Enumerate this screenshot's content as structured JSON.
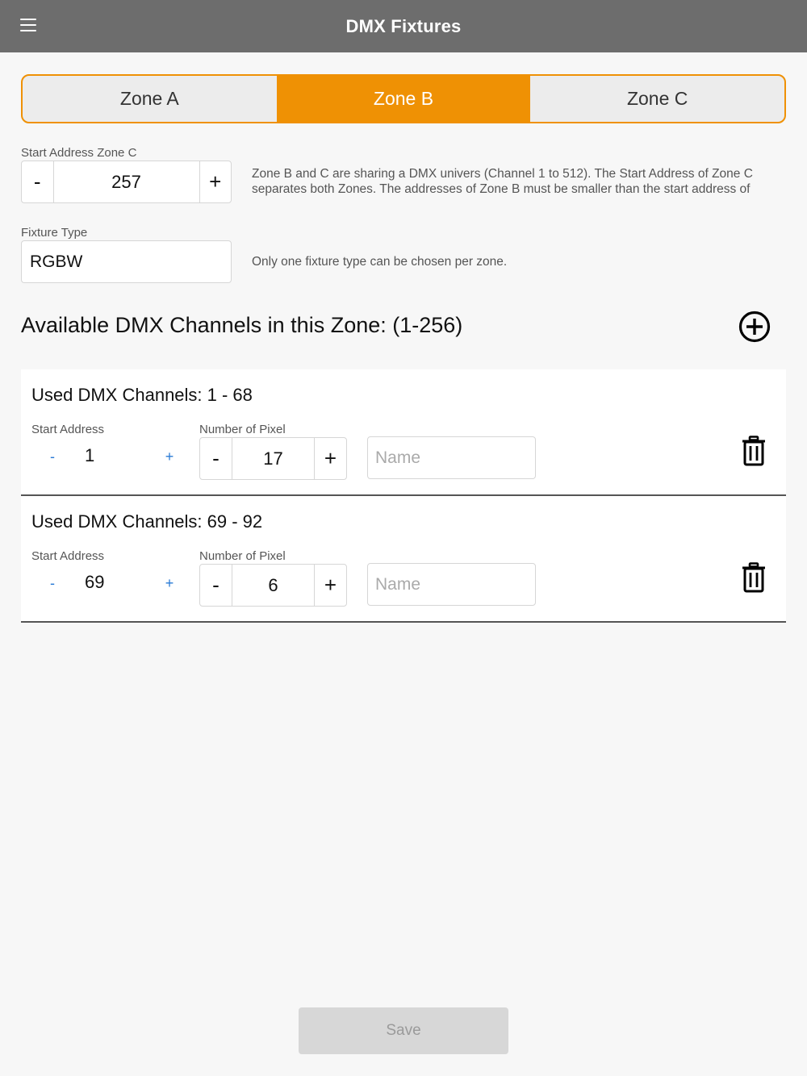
{
  "header": {
    "title": "DMX Fixtures",
    "menu_icon": "hamburger-menu-icon"
  },
  "zones": [
    {
      "label": "Zone A",
      "active": false
    },
    {
      "label": "Zone B",
      "active": true
    },
    {
      "label": "Zone C",
      "active": false
    }
  ],
  "start_address": {
    "label": "Start Address Zone C",
    "minus": "-",
    "value": "257",
    "plus": "+",
    "help": "Zone B and C are sharing a DMX univers (Channel 1 to 512). The Start Address of Zone C separates both Zones. The addresses of Zone B must be smaller than the start address of"
  },
  "fixture_type": {
    "label": "Fixture Type",
    "value": "RGBW",
    "help": "Only one fixture type can be chosen per zone."
  },
  "channels": {
    "title": "Available DMX Channels in this Zone: (1-256)"
  },
  "fixtures": [
    {
      "used": "Used DMX Channels: 1 - 68",
      "start_label": "Start Address",
      "start_value": "1",
      "pixel_label": "Number of Pixel",
      "pixel_value": "17",
      "name_placeholder": "Name"
    },
    {
      "used": "Used DMX Channels: 69 - 92",
      "start_label": "Start Address",
      "start_value": "69",
      "pixel_label": "Number of Pixel",
      "pixel_value": "6",
      "name_placeholder": "Name"
    }
  ],
  "common": {
    "minus": "-",
    "plus": "+"
  },
  "footer": {
    "save_label": "Save"
  },
  "colors": {
    "accent": "#ef9104",
    "header": "#6d6d6d",
    "link": "#2a7bd6"
  }
}
